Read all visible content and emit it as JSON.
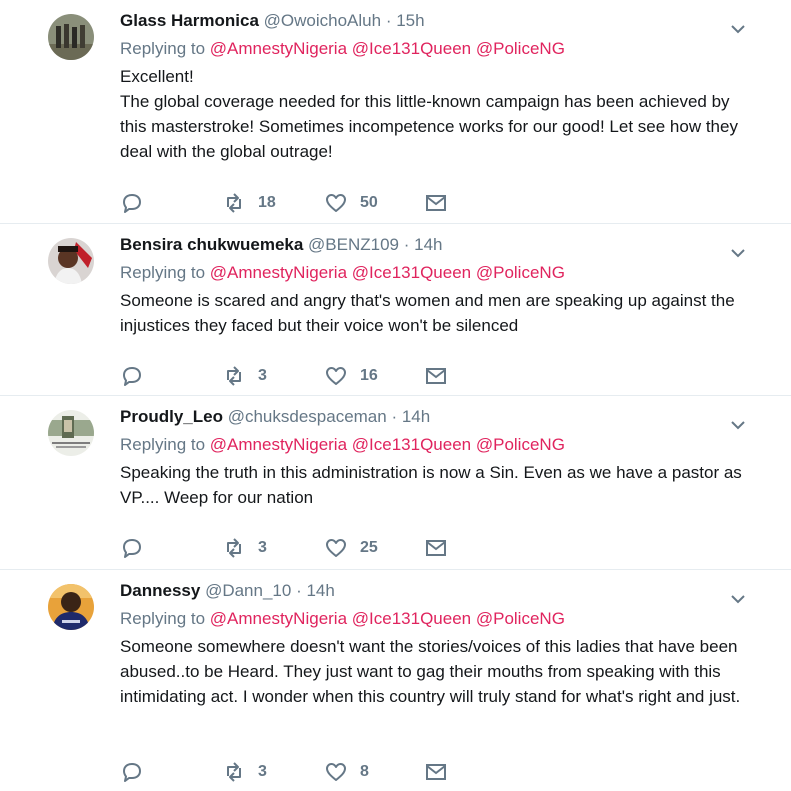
{
  "reply_prefix": "Replying to",
  "tweets": [
    {
      "name": "Glass Harmonica",
      "handle": "@OwoichoAluh",
      "time": "· 15h",
      "mentions": [
        "@AmnestyNigeria",
        "@Ice131Queen",
        "@PoliceNG"
      ],
      "text": [
        "Excellent!",
        "The global coverage needed for this little-known campaign has been achieved by this masterstroke! Sometimes incompetence works for our good! Let see how they deal with the global outrage!"
      ],
      "replies": "",
      "retweets": "18",
      "likes": "50"
    },
    {
      "name": "Bensira chukwuemeka",
      "handle": "@BENZ109",
      "time": "· 14h",
      "mentions": [
        "@AmnestyNigeria",
        "@Ice131Queen",
        "@PoliceNG"
      ],
      "text": [
        "Someone is scared and angry that's women and men are speaking up against the injustices  they faced but their voice won't be silenced"
      ],
      "replies": "",
      "retweets": "3",
      "likes": "16"
    },
    {
      "name": "Proudly_Leo",
      "handle": "@chuksdespaceman",
      "time": "· 14h",
      "mentions": [
        "@AmnestyNigeria",
        "@Ice131Queen",
        "@PoliceNG"
      ],
      "text": [
        "Speaking the truth in this administration is now a Sin. Even as we have a pastor as VP.... Weep for our nation"
      ],
      "replies": "",
      "retweets": "3",
      "likes": "25"
    },
    {
      "name": "Dannessy",
      "handle": "@Dann_10",
      "time": "· 14h",
      "mentions": [
        "@AmnestyNigeria",
        "@Ice131Queen",
        "@PoliceNG"
      ],
      "text": [
        "Someone somewhere doesn't want the stories/voices of this ladies that have been abused..to be Heard. They just want to gag their mouths from speaking with this intimidating act. I wonder when this country will truly stand for what's right and just."
      ],
      "replies": "",
      "retweets": "3",
      "likes": "8"
    }
  ],
  "icons": {
    "reply": "reply-icon",
    "retweet": "retweet-icon",
    "like": "heart-icon",
    "dm": "envelope-icon",
    "menu": "chevron-down-icon"
  },
  "colors": {
    "mention": "#e0245e",
    "secondary": "#657786",
    "divider": "#e6ecf0"
  }
}
